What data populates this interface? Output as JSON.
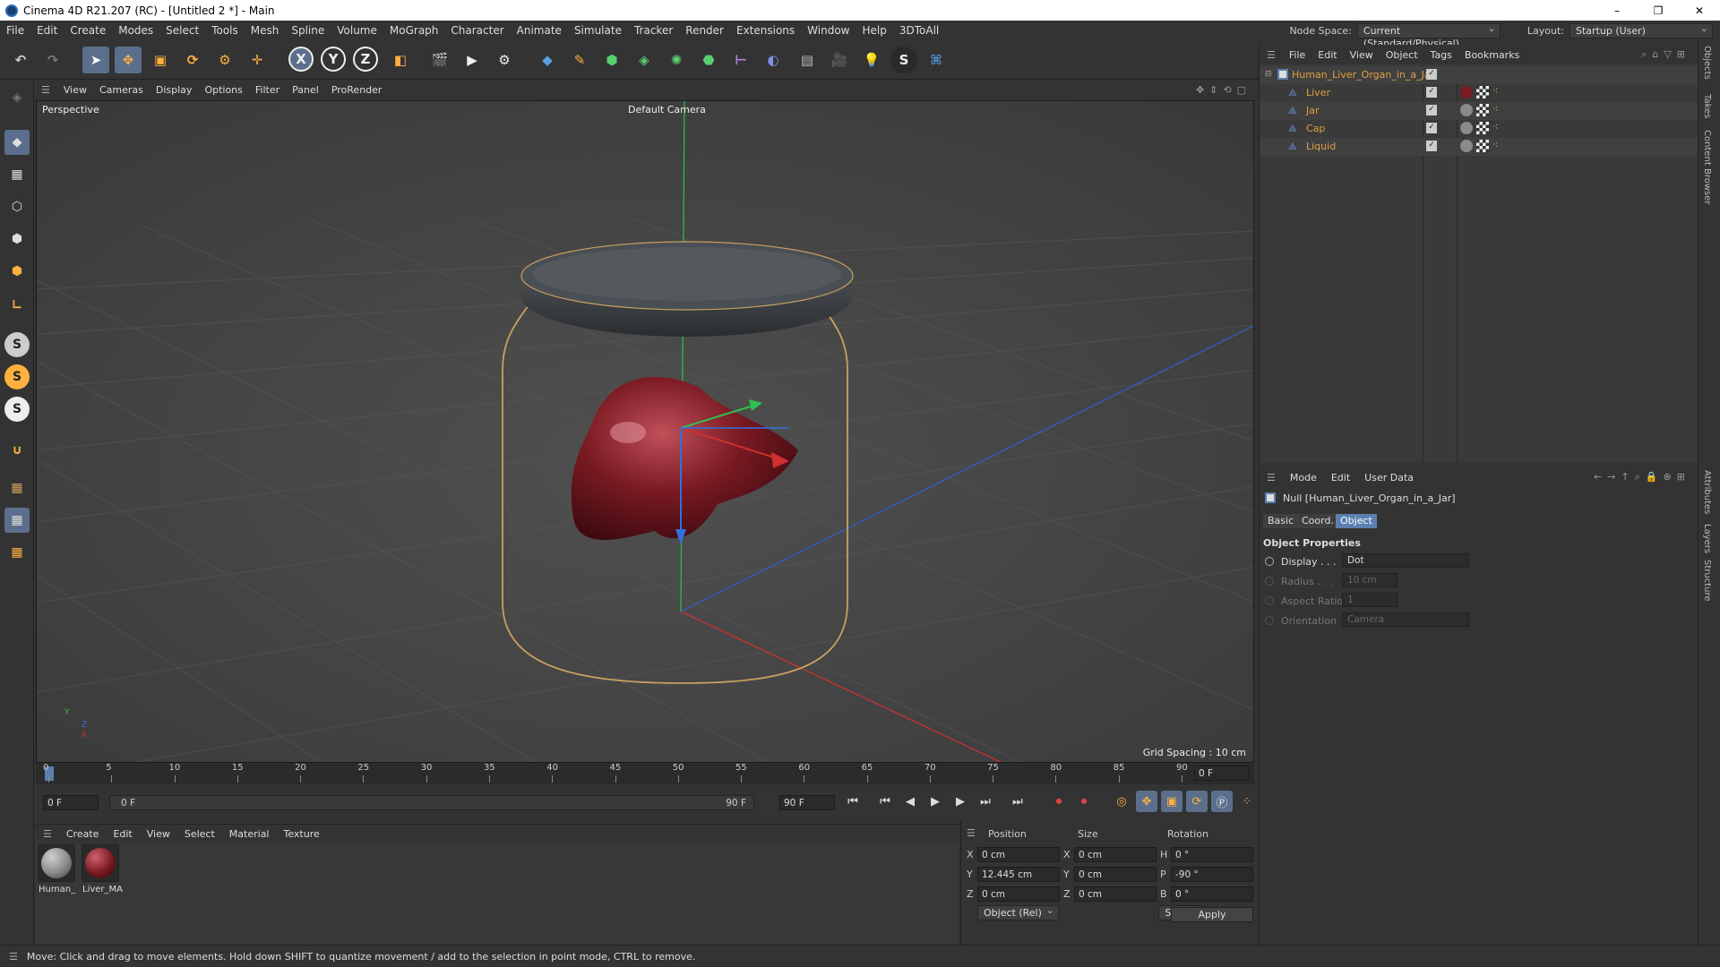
{
  "window": {
    "title": "Cinema 4D R21.207 (RC) - [Untitled 2 *] - Main",
    "controls": [
      "–",
      "❐",
      "✕"
    ]
  },
  "menubar": {
    "items": [
      "File",
      "Edit",
      "Create",
      "Modes",
      "Select",
      "Tools",
      "Mesh",
      "Spline",
      "Volume",
      "MoGraph",
      "Character",
      "Animate",
      "Simulate",
      "Tracker",
      "Render",
      "Extensions",
      "Window",
      "Help",
      "3DToAll"
    ],
    "node_space_label": "Node Space:",
    "node_space_value": "Current (Standard/Physical)",
    "layout_label": "Layout:",
    "layout_value": "Startup (User)"
  },
  "viewport": {
    "menu": [
      "View",
      "Cameras",
      "Display",
      "Options",
      "Filter",
      "Panel",
      "ProRender"
    ],
    "view_name": "Perspective",
    "camera": "Default Camera",
    "grid_spacing": "Grid Spacing : 10 cm",
    "axis_labels": {
      "y": "Y",
      "z": "Z",
      "x": "X"
    }
  },
  "timeline": {
    "ticks": [
      "0",
      "5",
      "10",
      "15",
      "20",
      "25",
      "30",
      "35",
      "40",
      "45",
      "50",
      "55",
      "60",
      "65",
      "70",
      "75",
      "80",
      "85",
      "90"
    ],
    "current_frame_display": "0 F",
    "start_field": "0 F",
    "range_start": "0 F",
    "range_end": "90 F",
    "end_field": "90 F"
  },
  "material_manager": {
    "menu": [
      "Create",
      "Edit",
      "View",
      "Select",
      "Material",
      "Texture"
    ],
    "materials": [
      {
        "label": "Human_",
        "color": "#8a8a8a"
      },
      {
        "label": "Liver_MA",
        "color": "#7a1a22"
      }
    ]
  },
  "coordinates": {
    "headers": {
      "position": "Position",
      "size": "Size",
      "rotation": "Rotation"
    },
    "rows": [
      {
        "axis": "X",
        "pos": "0 cm",
        "size_axis": "X",
        "size": "0 cm",
        "rot_axis": "H",
        "rot": "0 °"
      },
      {
        "axis": "Y",
        "pos": "12.445 cm",
        "size_axis": "Y",
        "size": "0 cm",
        "rot_axis": "P",
        "rot": "-90 °"
      },
      {
        "axis": "Z",
        "pos": "0 cm",
        "size_axis": "Z",
        "size": "0 cm",
        "rot_axis": "B",
        "rot": "0 °"
      }
    ],
    "mode_select": "Object (Rel)",
    "size_select": "Size",
    "apply_label": "Apply"
  },
  "status": {
    "text": "Move: Click and drag to move elements. Hold down SHIFT to quantize movement / add to the selection in point mode, CTRL to remove."
  },
  "object_manager": {
    "menu": [
      "File",
      "Edit",
      "View",
      "Object",
      "Tags",
      "Bookmarks"
    ],
    "root": "Human_Liver_Organ_in_a_Jar",
    "children": [
      "Liver",
      "Jar",
      "Cap",
      "Liquid"
    ]
  },
  "attributes": {
    "menu": [
      "Mode",
      "Edit",
      "User Data"
    ],
    "object_title": "Null [Human_Liver_Organ_in_a_Jar]",
    "tabs": [
      "Basic",
      "Coord.",
      "Object"
    ],
    "active_tab": "Object",
    "section": "Object Properties",
    "props": [
      {
        "label": "Display . . .",
        "value": "Dot",
        "enabled": true
      },
      {
        "label": "Radius . . .",
        "value": "10 cm",
        "enabled": false
      },
      {
        "label": "Aspect Ratio",
        "value": "1",
        "enabled": false
      },
      {
        "label": "Orientation",
        "value": "Camera",
        "enabled": false
      }
    ]
  },
  "edge_tabs": {
    "top": [
      "Objects",
      "Takes",
      "Content Browser"
    ],
    "bottom": [
      "Attributes",
      "Layers",
      "Structure"
    ]
  },
  "colors": {
    "accent": "#5b7fb0",
    "object_name": "#e0a040",
    "liver": "#7a1a22",
    "jar_outline": "#c8a060"
  }
}
